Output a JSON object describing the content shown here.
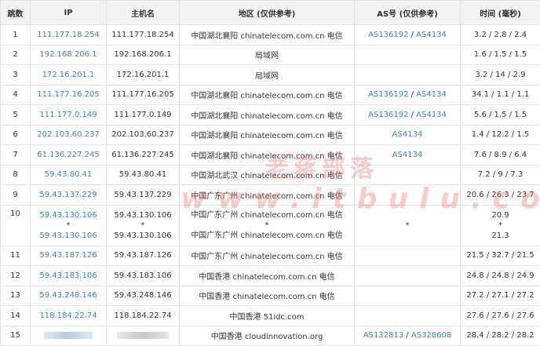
{
  "headers": {
    "hop": "跳数",
    "ip": "IP",
    "host": "主机名",
    "region": "地区 (仅供参考)",
    "as": "AS号 (仅供参考)",
    "time": "时间 (毫秒)"
  },
  "rows": [
    {
      "hop": "1",
      "ip": "111.177.18.254",
      "host": "111.177.18.254",
      "region": "中国湖北襄阳 chinatelecom.com.cn 电信",
      "as": [
        "AS136192",
        "AS4134"
      ],
      "time": "3.2 / 2.8 / 2.4"
    },
    {
      "hop": "2",
      "ip": "192.168.206.1",
      "host": "192.168.206.1",
      "region": "局域网",
      "as": [],
      "time": "1.6 / 1.5 / 1.5"
    },
    {
      "hop": "3",
      "ip": "172.16.201.1",
      "host": "172.16.201.1",
      "region": "局域网",
      "as": [],
      "time": "3.2 / 14 / 2.9"
    },
    {
      "hop": "4",
      "ip": "111.177.16.205",
      "host": "111.177.16.205",
      "region": "中国湖北襄阳 chinatelecom.com.cn 电信",
      "as": [
        "AS136192",
        "AS4134"
      ],
      "time": "34.1 / 1.1 / 1.1"
    },
    {
      "hop": "5",
      "ip": "111.177.0.149",
      "host": "111.177.0.149",
      "region": "中国湖北襄阳 chinatelecom.com.cn 电信",
      "as": [
        "AS136192",
        "AS4134"
      ],
      "time": "5.6 / 1.5 / 1.5"
    },
    {
      "hop": "6",
      "ip": "202.103.60.237",
      "host": "202.103.60.237",
      "region": "中国湖北襄阳 chinatelecom.com.cn 电信",
      "as": [
        "AS4134"
      ],
      "time": "1.4 / 12.2 / 1.5"
    },
    {
      "hop": "7",
      "ip": "61.136.227.245",
      "host": "61.136.227.245",
      "region": "中国湖北襄阳 chinatelecom.com.cn 电信",
      "as": [
        "AS4134"
      ],
      "time": "7.6 / 8.9 / 6.4"
    },
    {
      "hop": "8",
      "ip": "59.43.80.41",
      "host": "59.43.80.41",
      "region": "中国湖北武汉 chinatelecom.com.cn 电信",
      "as": [],
      "time": "7.2 / 9 / 7.3"
    },
    {
      "hop": "9",
      "ip": "59.43.137.229",
      "host": "59.43.137.229",
      "region": "中国广东广州 chinatelecom.com.cn 电信",
      "as": [],
      "time": "20.6 / 26.3 / 23.7"
    },
    {
      "hop": "11",
      "ip": "59.43.187.126",
      "host": "59.43.187.126",
      "region": "中国广东广州 chinatelecom.com.cn 电信",
      "as": [],
      "time": "21.5 / 32.7 / 21.5"
    },
    {
      "hop": "12",
      "ip": "59.43.183.106",
      "host": "59.43.183.106",
      "region": "中国香港 chinatelecom.com.cn 电信",
      "as": [],
      "time": "24.8 / 24.8 / 24.9"
    },
    {
      "hop": "13",
      "ip": "59.43.248.146",
      "host": "59.43.248.146",
      "region": "中国香港 chinatelecom.com.cn 电信",
      "as": [],
      "time": "27.2 / 27.1 / 27.2"
    },
    {
      "hop": "14",
      "ip": "118.184.22.74",
      "host": "118.184.22.74",
      "region": "中国香港 51idc.com",
      "as": [],
      "time": "27.6 / 27.6 / 27.6"
    }
  ],
  "row10": {
    "hop": "10",
    "ip_a": "59.43.130.106",
    "ip_b": "59.43.130.106",
    "host_a": "59.43.130.106",
    "host_b": "59.43.130.106",
    "region_a": "中国广东广州 chinatelecom.com.cn 电信",
    "region_b": "中国广东广州 chinatelecom.com.cn 电信",
    "star": "*",
    "time_a": "20.9",
    "time_b": "21.3"
  },
  "row15": {
    "hop": "15",
    "region": "中国香港 cloudinnovation.org",
    "as_a": "AS132813",
    "as_b": "AS328608",
    "time": "28.4 / 28.2 / 28.2"
  },
  "watermark": {
    "line1": "老蒋部落",
    "line2": "www.itbulu.com"
  },
  "colors": {
    "link": "#3d7fc1",
    "header_bg": "#f3f3f3",
    "border": "#e4e4e4"
  }
}
